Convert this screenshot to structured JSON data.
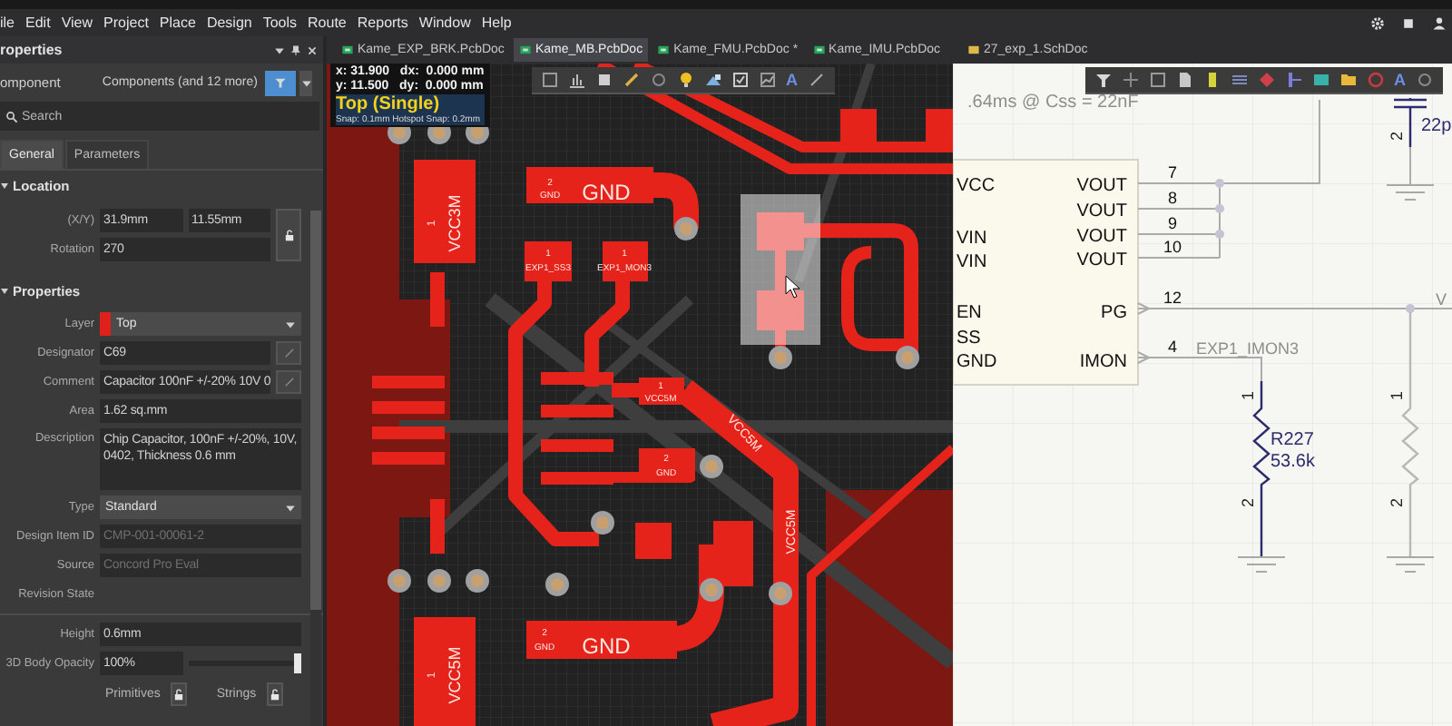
{
  "menu_bar": {
    "items": [
      "ile",
      "Edit",
      "View",
      "Project",
      "Place",
      "Design",
      "Tools",
      "Route",
      "Reports",
      "Window",
      "Help"
    ]
  },
  "document_tabs": [
    {
      "label": "Kame_EXP_BRK.PcbDoc",
      "kind": "pcb",
      "selected": false
    },
    {
      "label": "Kame_MB.PcbDoc",
      "kind": "pcb",
      "selected": true
    },
    {
      "label": "Kame_FMU.PcbDoc *",
      "kind": "pcb",
      "selected": false
    },
    {
      "label": "Kame_IMU.PcbDoc",
      "kind": "pcb",
      "selected": false
    },
    {
      "label": "27_exp_1.SchDoc",
      "kind": "sch",
      "selected": false
    }
  ],
  "properties_panel": {
    "title": "roperties",
    "object_type": "omponent",
    "filter": "Components (and 12 more)",
    "search": {
      "placeholder": "Search"
    },
    "tabs": [
      {
        "label": "General",
        "selected": true
      },
      {
        "label": "Parameters",
        "selected": false
      }
    ],
    "sections": [
      {
        "title": "Location",
        "expanded": true,
        "rows": [
          {
            "kind": "pair",
            "label": "(X/Y)",
            "values": [
              "31.9mm",
              "11.55mm"
            ],
            "locked": false
          },
          {
            "kind": "field",
            "label": "Rotation",
            "value": "270",
            "disabled": false
          }
        ]
      },
      {
        "title": "Properties",
        "expanded": true,
        "rows": [
          {
            "kind": "layer",
            "label": "Layer",
            "value": "Top",
            "color": "#e0201a"
          },
          {
            "kind": "field_button",
            "label": "Designator",
            "value": "C69",
            "disabled": false
          },
          {
            "kind": "field_button",
            "label": "Comment",
            "value": "Capacitor 100nF +/-20% 10V 0",
            "disabled": false
          },
          {
            "kind": "field",
            "label": "Area",
            "value": "1.62 sq.mm",
            "disabled": false
          },
          {
            "kind": "textarea",
            "label": "Description",
            "value": "Chip Capacitor, 100nF +/-20%, 10V, 0402, Thickness 0.6 mm",
            "disabled": false
          },
          {
            "kind": "dropdown",
            "label": "Type",
            "value": "Standard"
          },
          {
            "kind": "field",
            "label": "Design Item ID",
            "value": "CMP-001-00061-2",
            "disabled": true
          },
          {
            "kind": "field",
            "label": "Source",
            "value": "Concord Pro Eval",
            "disabled": true
          },
          {
            "kind": "label",
            "label": "Revision State"
          }
        ]
      },
      {
        "rows": [
          {
            "kind": "field",
            "label": "Height",
            "value": "0.6mm",
            "disabled": false
          },
          {
            "kind": "slider",
            "label": "3D Body Opacity",
            "value": "100%",
            "level": 1
          },
          {
            "kind": "locks",
            "items": [
              {
                "label": "Primitives",
                "locked": false
              },
              {
                "label": "Strings",
                "locked": false
              }
            ]
          }
        ]
      }
    ]
  },
  "pcb_view": {
    "cursor_readout": [
      "x: 31.900   dx:  0.000 mm",
      "y: 11.500   dy:  0.000 mm"
    ],
    "layer_mode": "Top (Single)",
    "snap": "Snap: 0.1mm Hotspot Snap: 0.2mm",
    "toolbar_glyph": "A",
    "pad_labels": [
      "1",
      "VCC3M",
      "2",
      "GND",
      "GND",
      "1",
      "EXP1_SS3",
      "1",
      "EXP1_MON3",
      "1",
      "VCC5M",
      "VCC5M",
      "2",
      "GND",
      "VCC5M",
      "1",
      "VCC5M",
      "2",
      "GND",
      "GND"
    ]
  },
  "schematic_view": {
    "toolbar_glyph": "A",
    "note": ".64ms @ Css = 22nF",
    "capacitor": {
      "pin": "2",
      "value": "22p"
    },
    "ic": {
      "left_pins": [
        "VCC",
        "VIN",
        "VIN",
        "EN",
        "SS",
        "GND"
      ],
      "right_pins": [
        {
          "name": "VOUT",
          "number": "7"
        },
        {
          "name": "VOUT",
          "number": "8"
        },
        {
          "name": "VOUT",
          "number": "9"
        },
        {
          "name": "VOUT",
          "number": "10"
        },
        {
          "name": "PG",
          "number": "12"
        },
        {
          "name": "IMON",
          "number": "4"
        }
      ]
    },
    "net_label": "EXP1_IMON3",
    "resistors": [
      {
        "designator": "R227",
        "value": "53.6k",
        "pins": [
          "1",
          "2"
        ]
      },
      {
        "pins": [
          "1",
          "2"
        ]
      }
    ],
    "offpage_text": "V"
  }
}
